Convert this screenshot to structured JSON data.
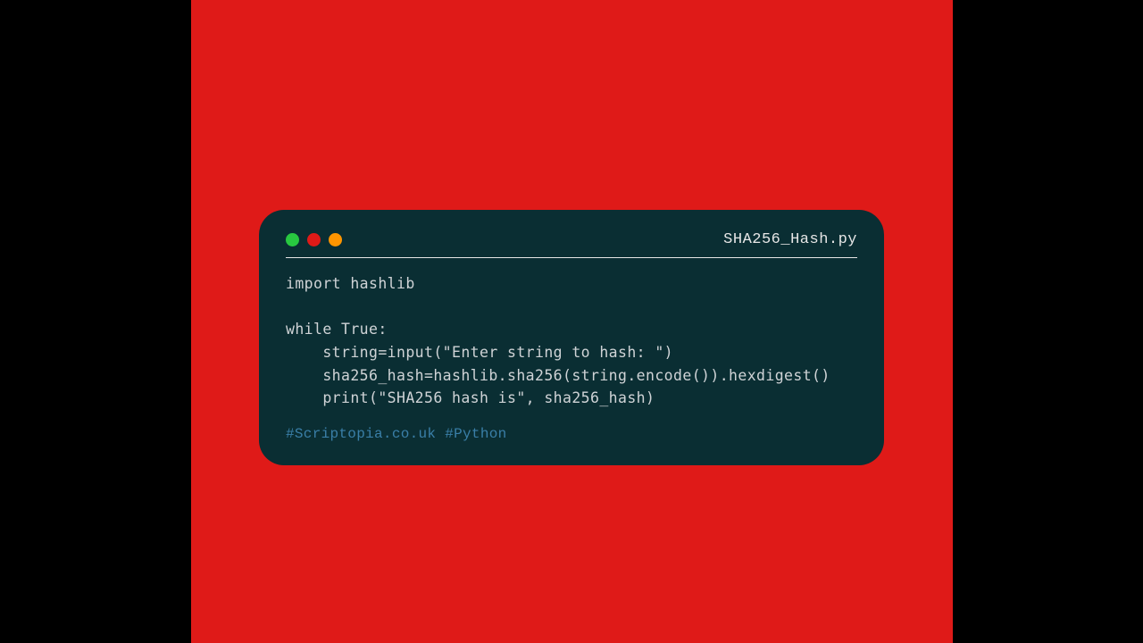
{
  "window": {
    "filename": "SHA256_Hash.py",
    "code_lines": [
      "import hashlib",
      "",
      "while True:",
      "    string=input(\"Enter string to hash: \")",
      "    sha256_hash=hashlib.sha256(string.encode()).hexdigest()",
      "    print(\"SHA256 hash is\", sha256_hash)"
    ],
    "tags": "#Scriptopia.co.uk #Python"
  },
  "colors": {
    "background_outer": "#000000",
    "background_panel": "#df1a18",
    "window_bg": "#0a2e33",
    "traffic_green": "#28c840",
    "traffic_red": "#df1a18",
    "traffic_orange": "#ff9500",
    "text_primary": "#cfd3d6",
    "tag_blue": "#3a7fa8"
  }
}
